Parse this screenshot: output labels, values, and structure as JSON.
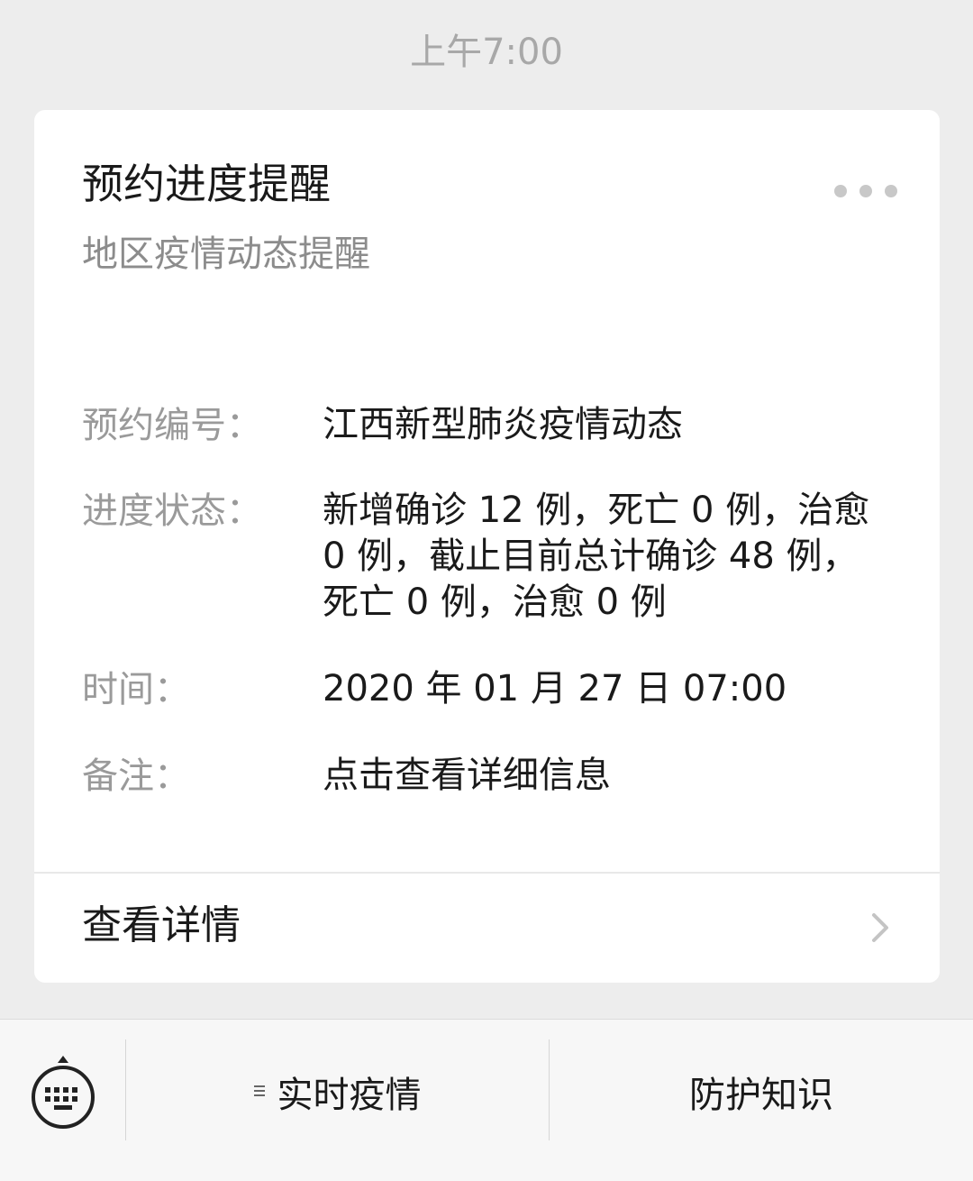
{
  "chat": {
    "timestamp": "上午7:00"
  },
  "card": {
    "title": "预约进度提醒",
    "subtitle": "地区疫情动态提醒",
    "more_icon": "ellipsis-icon",
    "fields": [
      {
        "label": "预约编号：",
        "value": "江西新型肺炎疫情动态"
      },
      {
        "label": "进度状态：",
        "value": "新增确诊 12 例，死亡 0 例，治愈 0 例，截止目前总计确诊 48 例，死亡 0 例，治愈 0 例"
      },
      {
        "label": "时间：",
        "value": "2020 年 01 月 27 日 07:00"
      },
      {
        "label": "备注：",
        "value": "点击查看详细信息"
      }
    ],
    "detail_link": "查看详情",
    "detail_icon": "chevron-right-icon"
  },
  "bottom_menu": {
    "keyboard_icon": "keyboard-icon",
    "items": [
      {
        "label": "实时疫情",
        "icon": "submenu-icon"
      },
      {
        "label": "防护知识"
      }
    ]
  },
  "colors": {
    "background": "#ededed",
    "card": "#ffffff",
    "label_gray": "#9a9a9a",
    "text_dark": "#1a1a1a"
  }
}
